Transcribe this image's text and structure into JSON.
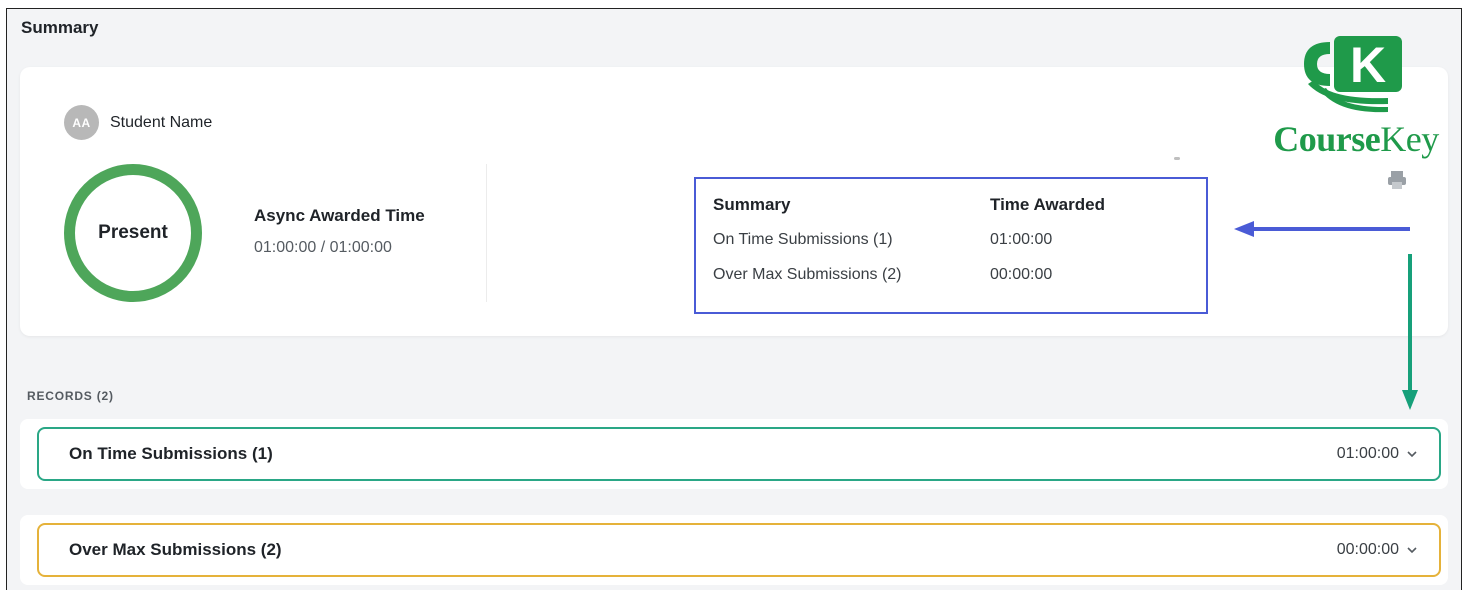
{
  "page": {
    "title": "Summary"
  },
  "student": {
    "initials": "AA",
    "name": "Student Name"
  },
  "status": {
    "label": "Present",
    "color": "#4ea65a"
  },
  "async": {
    "label": "Async Awarded Time",
    "value": "01:00:00 / 01:00:00"
  },
  "summary_table": {
    "headers": {
      "summary": "Summary",
      "time": "Time Awarded"
    },
    "rows": [
      {
        "label": "On Time Submissions (1)",
        "time": "01:00:00"
      },
      {
        "label": "Over Max Submissions (2)",
        "time": "00:00:00"
      }
    ],
    "border_color": "#4a5bd6"
  },
  "logo": {
    "letter": "K",
    "name_bold": "Course",
    "name_light": "Key",
    "color": "#1f9a4a"
  },
  "records": {
    "heading": "RECORDS (2)",
    "items": [
      {
        "title": "On Time Submissions (1)",
        "time": "01:00:00",
        "border_color": "#2aa786"
      },
      {
        "title": "Over Max Submissions (2)",
        "time": "00:00:00",
        "border_color": "#e5b23a"
      }
    ]
  },
  "annotations": {
    "arrow_left_color": "#4a5bd6",
    "arrow_down_color": "#16a07a"
  },
  "icons": [
    "printer-icon",
    "chevron-down-icon",
    "arrow-left-icon",
    "arrow-down-icon"
  ]
}
